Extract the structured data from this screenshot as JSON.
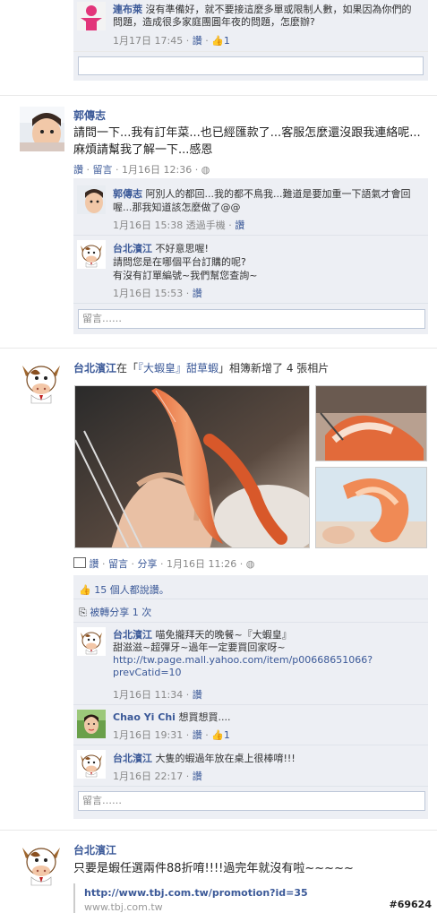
{
  "post0": {
    "comment": {
      "name": "連布萊",
      "text": " 沒有準備好，就不要接這麼多單或限制人數，如果因為你們的問題，造成很多家庭團圓年夜的問題，怎麼辦?",
      "time": "1月17日 17:45",
      "like_label": "讚",
      "like_count": "1"
    }
  },
  "post1": {
    "author": "郭傳志",
    "text": "請問一下...我有訂年菜...也已經匯款了...客服怎麼還沒跟我連絡呢...麻煩請幫我了解一下...感恩",
    "actions": {
      "like": "讚",
      "comment": "留言",
      "time": "1月16日 12:36"
    },
    "comments": [
      {
        "name": "郭傳志",
        "text": " 阿別人的都回...我的都不鳥我...難道是要加重一下語氣才會回喔...那我知道該怎麼做了@@",
        "time": "1月16日 15:38",
        "via": "透過手機",
        "like": "讚"
      },
      {
        "name": "台北濱江",
        "text": " 不好意思喔!",
        "text2": "請問您是在哪個平台訂購的呢?",
        "text3": "有沒有訂單編號~我們幫您查詢~",
        "time": "1月16日 15:53",
        "like": "讚"
      }
    ],
    "comment_placeholder": "留言……"
  },
  "post2": {
    "author": "台北濱江",
    "pre": "在「",
    "album": "『大蝦皇』甜草蝦",
    "post": "」相簿新增了 4 張相片",
    "actions": {
      "like": "讚",
      "comment": "留言",
      "share": "分享",
      "time": "1月16日 11:26"
    },
    "likes_text": "15 個人都說讚。",
    "shares_text": "被轉分享 1 次",
    "comments": [
      {
        "name": "台北濱江",
        "text": " 喵免攏拜天的晚餐~『大蝦皇』",
        "text2": "甜滋滋~超彈牙~過年一定要買回家呀~",
        "link1": "http://tw.page.mall.yahoo.com/item/p00668651066?",
        "link2": "prevCatid=10",
        "time": "1月16日 11:34",
        "like": "讚"
      },
      {
        "name": "Chao Yi Chi",
        "text": " 想買想買....",
        "time": "1月16日 19:31",
        "like": "讚",
        "like_count": "1"
      },
      {
        "name": "台北濱江",
        "text": " 大隻的蝦過年放在桌上很棒唷!!!",
        "time": "1月16日 22:17",
        "like": "讚"
      }
    ],
    "comment_placeholder": "留言……"
  },
  "post3": {
    "author": "台北濱江",
    "text": "只要是蝦任選兩件88折唷!!!!過完年就沒有啦~~~~~",
    "link_title": "http://www.tbj.com.tw/promotion?id=35",
    "link_domain": "www.tbj.com.tw"
  },
  "watermark": "#69624",
  "colors": {
    "link": "#3b5998",
    "comment_bg": "#edeff4",
    "meta": "#888888"
  }
}
